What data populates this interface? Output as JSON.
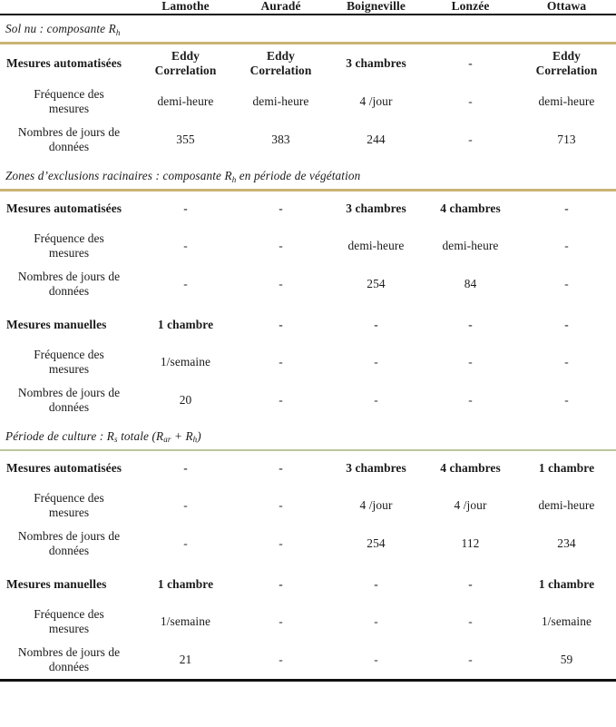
{
  "table": {
    "columns": [
      {
        "key": "label",
        "label": ""
      },
      {
        "key": "lamothe",
        "label": "Lamothe"
      },
      {
        "key": "aurade",
        "label": "Auradé"
      },
      {
        "key": "boigneville",
        "label": "Boigneville"
      },
      {
        "key": "lonzee",
        "label": "Lonzée"
      },
      {
        "key": "ottawa",
        "label": "Ottawa"
      }
    ],
    "row_labels": {
      "mesures_automatisees": "Mesures automatisées",
      "mesures_manuelles": "Mesures manuelles",
      "frequence_line1": "Fréquence des",
      "frequence_line2": "mesures",
      "nombres_line1": "Nombres de jours de",
      "nombres_line2": "données"
    },
    "sections": [
      {
        "id": "sol-nu",
        "title_prefix": "Sol nu : composante R",
        "title_sub": "h",
        "title_suffix": "",
        "rule_color": "#c9b474",
        "groups": [
          {
            "id": "automatisees",
            "main_row": {
              "label_key": "mesures_automatisees",
              "values": [
                "Eddy Correlation",
                "Eddy Correlation",
                "3 chambres",
                "-",
                "Eddy Correlation"
              ]
            },
            "sub_rows": [
              {
                "label_key": "frequence",
                "values": [
                  "demi-heure",
                  "demi-heure",
                  "4 /jour",
                  "-",
                  "demi-heure"
                ]
              },
              {
                "label_key": "nombres",
                "values": [
                  "355",
                  "383",
                  "244",
                  "-",
                  "713"
                ]
              }
            ]
          }
        ]
      },
      {
        "id": "zones-exclusions",
        "title_prefix": "Zones d’exclusions racinaires : composante R",
        "title_sub": "h",
        "title_suffix": " en période de végétation",
        "rule_color": "#c9b474",
        "groups": [
          {
            "id": "automatisees",
            "main_row": {
              "label_key": "mesures_automatisees",
              "values": [
                "-",
                "-",
                "3 chambres",
                "4 chambres",
                "-"
              ]
            },
            "sub_rows": [
              {
                "label_key": "frequence",
                "values": [
                  "-",
                  "-",
                  "demi-heure",
                  "demi-heure",
                  "-"
                ]
              },
              {
                "label_key": "nombres",
                "values": [
                  "-",
                  "-",
                  "254",
                  "84",
                  "-"
                ]
              }
            ]
          },
          {
            "id": "manuelles",
            "main_row": {
              "label_key": "mesures_manuelles",
              "values": [
                "1 chambre",
                "-",
                "-",
                "-",
                "-"
              ]
            },
            "sub_rows": [
              {
                "label_key": "frequence",
                "values": [
                  "1/semaine",
                  "-",
                  "-",
                  "-",
                  "-"
                ]
              },
              {
                "label_key": "nombres",
                "values": [
                  "20",
                  "-",
                  "-",
                  "-",
                  "-"
                ]
              }
            ]
          }
        ]
      },
      {
        "id": "periode-culture",
        "title_prefix": "Période de culture : R",
        "title_sub": "s",
        "title_suffix": " totale (R",
        "title_sub2": "ar",
        "title_suffix2": " + R",
        "title_sub3": "h",
        "title_suffix3": ")",
        "rule_color": "#b7c79a",
        "groups": [
          {
            "id": "automatisees",
            "main_row": {
              "label_key": "mesures_automatisees",
              "values": [
                "-",
                "-",
                "3 chambres",
                "4 chambres",
                "1 chambre"
              ]
            },
            "sub_rows": [
              {
                "label_key": "frequence",
                "values": [
                  "-",
                  "-",
                  "4 /jour",
                  "4 /jour",
                  "demi-heure"
                ]
              },
              {
                "label_key": "nombres",
                "values": [
                  "-",
                  "-",
                  "254",
                  "112",
                  "234"
                ]
              }
            ]
          },
          {
            "id": "manuelles",
            "main_row": {
              "label_key": "mesures_manuelles",
              "values": [
                "1 chambre",
                "-",
                "-",
                "-",
                "1 chambre"
              ]
            },
            "sub_rows": [
              {
                "label_key": "frequence",
                "values": [
                  "1/semaine",
                  "-",
                  "-",
                  "-",
                  "1/semaine"
                ]
              },
              {
                "label_key": "nombres",
                "values": [
                  "21",
                  "-",
                  "-",
                  "-",
                  "59"
                ]
              }
            ]
          }
        ]
      }
    ]
  },
  "colors": {
    "rule_gold": "#c9b474",
    "rule_green": "#b7c79a",
    "rule_black": "#111111",
    "text": "#1a1a1a"
  }
}
